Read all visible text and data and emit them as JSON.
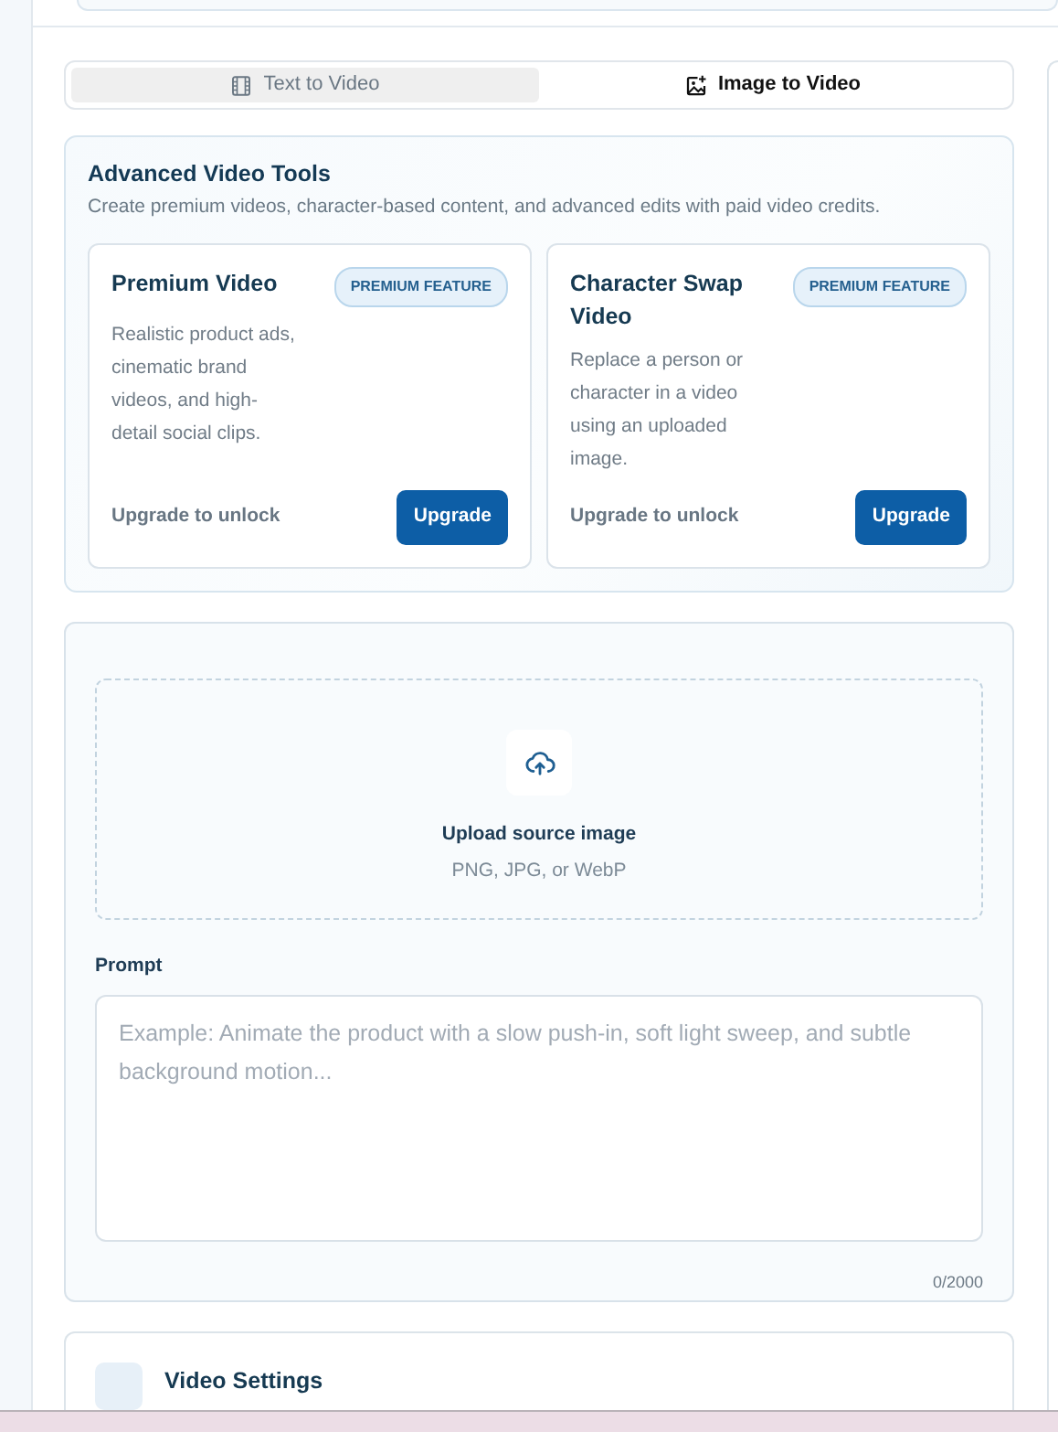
{
  "tabs": [
    {
      "label": "Text to Video",
      "selected": false
    },
    {
      "label": "Image to Video",
      "selected": true
    }
  ],
  "advanced_tools": {
    "title": "Advanced Video Tools",
    "description": "Create premium videos, character-based content, and advanced edits with paid video credits.",
    "cards": [
      {
        "title": "Premium Video",
        "badge": "PREMIUM FEATURE",
        "description": "Realistic product ads, cinematic brand videos, and high-detail social clips.",
        "note": "Upgrade to unlock",
        "button": "Upgrade"
      },
      {
        "title": "Character Swap Video",
        "badge": "PREMIUM FEATURE",
        "description": "Replace a person or character in a video using an uploaded image.",
        "note": "Upgrade to unlock",
        "button": "Upgrade"
      }
    ]
  },
  "upload": {
    "title": "Upload source image",
    "hint": "PNG, JPG, or WebP"
  },
  "prompt": {
    "label": "Prompt",
    "placeholder": "Example: Animate the product with a slow push-in, soft light sweep, and subtle background motion...",
    "counter": "0/2000"
  },
  "video_settings": {
    "title": "Video Settings"
  }
}
